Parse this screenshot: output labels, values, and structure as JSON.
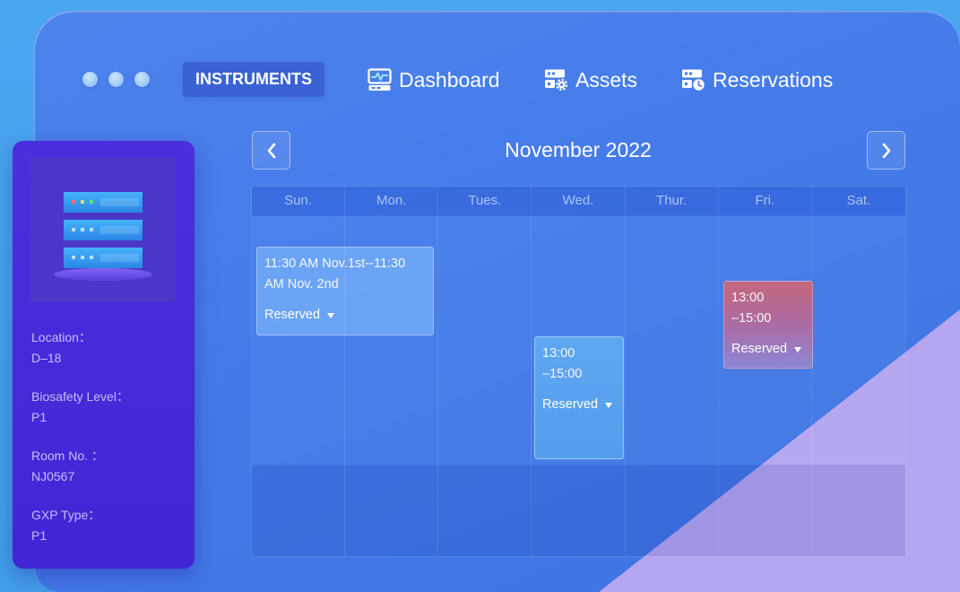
{
  "colors": {
    "page_background": "#44a3f0",
    "window": "#4179ea",
    "sidebar": "#4427dc",
    "lavender_accent": "#b4a6f0",
    "event_blue": "#58a3f2",
    "event_red": "#c4677e"
  },
  "nav": {
    "brand_label": "INSTRUMENTS",
    "items": [
      {
        "label": "Dashboard",
        "icon": "dashboard-icon"
      },
      {
        "label": "Assets",
        "icon": "assets-icon"
      },
      {
        "label": "Reservations",
        "icon": "reservations-icon"
      }
    ]
  },
  "instrument": {
    "image_icon": "server-rack-icon",
    "fields": [
      {
        "label": "Location：",
        "value": "D–18"
      },
      {
        "label": "Biosafety Level：",
        "value": "P1"
      },
      {
        "label": "Room No. ：",
        "value": "NJ0567"
      },
      {
        "label": "GXP Type：",
        "value": "P1"
      }
    ]
  },
  "calendar": {
    "title": "November 2022",
    "prev_icon": "chevron-left-icon",
    "next_icon": "chevron-right-icon",
    "weekdays": [
      "Sun.",
      "Mon.",
      "Tues.",
      "Wed.",
      "Thur.",
      "Fri.",
      "Sat."
    ],
    "events": [
      {
        "time_lines": [
          "11:30 AM Nov.1st--11:30",
          "AM Nov. 2nd"
        ],
        "status": "Reserved"
      },
      {
        "time_lines": [
          "13:00",
          "–15:00"
        ],
        "status": "Reserved"
      },
      {
        "time_lines": [
          "13:00",
          "–15:00"
        ],
        "status": "Reserved"
      }
    ]
  }
}
